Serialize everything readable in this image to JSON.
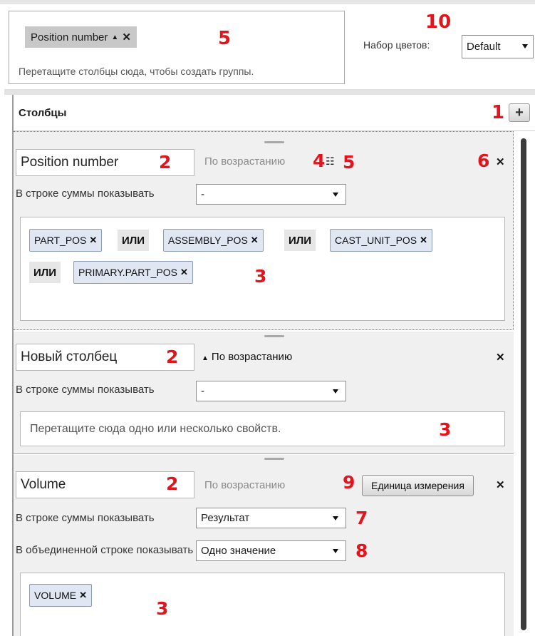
{
  "group_area": {
    "tag": {
      "label": "Position number",
      "sort_icon": "triangle-up-icon",
      "remove_icon": "close-icon"
    },
    "hint": "Перетащите столбцы сюда, чтобы создать группы."
  },
  "color_set": {
    "label": "Набор цветов:",
    "value": "Default"
  },
  "columns": {
    "title": "Столбцы",
    "add_button": "+",
    "items": [
      {
        "name": "Position number",
        "sort": "По возрастанию",
        "sort_active": false,
        "sum_label": "В строке суммы показывать",
        "sum_value": "-",
        "properties": [
          "PART_POS",
          "ASSEMBLY_POS",
          "CAST_UNIT_POS",
          "PRIMARY.PART_POS"
        ],
        "or_label": "ИЛИ"
      },
      {
        "name": "Новый столбец",
        "sort": "По возрастанию",
        "sort_active": true,
        "sum_label": "В строке суммы показывать",
        "sum_value": "-",
        "drop_hint": "Перетащите сюда одно или несколько свойств."
      },
      {
        "name": "Volume",
        "sort": "По возрастанию",
        "sort_active": false,
        "unit_button": "Единица измерения",
        "sum_label": "В строке суммы показывать",
        "sum_value": "Результат",
        "merged_label": "В объединенной строке показывать",
        "merged_value": "Одно значение",
        "properties": [
          "VOLUME"
        ]
      }
    ]
  },
  "callouts": {
    "group_tag": "5",
    "color_set": "10",
    "add_column": "1",
    "column_name": "2",
    "properties": "3",
    "sort_order": "4",
    "group_by": "5",
    "delete": "6",
    "sum_row": "7",
    "merged_row": "8",
    "unit": "9"
  },
  "colors": {
    "callout": "#e3141c",
    "chip_bg": "#e0e7f3",
    "panel_bg": "#f0f0f0"
  }
}
